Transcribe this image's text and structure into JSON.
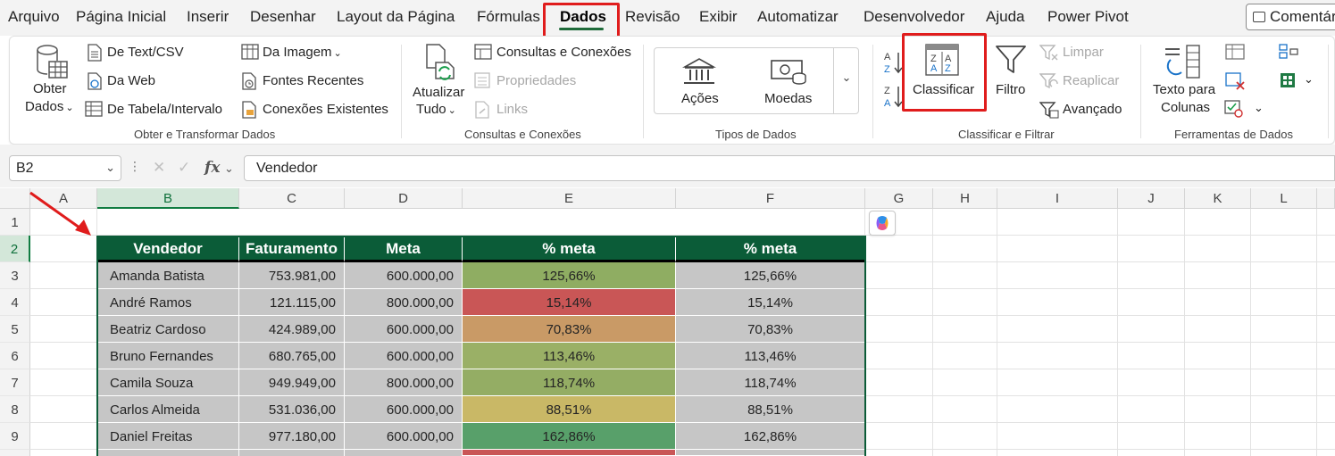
{
  "menu": {
    "items": [
      "Arquivo",
      "Página Inicial",
      "Inserir",
      "Desenhar",
      "Layout da Página",
      "Fórmulas",
      "Dados",
      "Revisão",
      "Exibir",
      "Automatizar",
      "Desenvolvedor",
      "Ajuda",
      "Power Pivot"
    ],
    "active": "Dados",
    "comment_label": "Comentár"
  },
  "ribbon": {
    "get_data": {
      "obter": "Obter",
      "dados": "Dados",
      "from_text": "De Text/CSV",
      "from_web": "Da Web",
      "from_table": "De Tabela/Intervalo",
      "from_image": "Da Imagem",
      "recent_sources": "Fontes Recentes",
      "existing_connections": "Conexões Existentes",
      "group": "Obter e Transformar Dados"
    },
    "queries": {
      "refresh_1": "Atualizar",
      "refresh_2": "Tudo",
      "queries_connections": "Consultas e Conexões",
      "properties": "Propriedades",
      "links": "Links",
      "group": "Consultas e Conexões"
    },
    "data_types": {
      "stocks": "Ações",
      "currencies": "Moedas",
      "group": "Tipos de Dados"
    },
    "sort_filter": {
      "sort": "Classificar",
      "filter": "Filtro",
      "clear": "Limpar",
      "reapply": "Reaplicar",
      "advanced": "Avançado",
      "group": "Classificar e Filtrar"
    },
    "data_tools": {
      "text_to_columns_1": "Texto para",
      "text_to_columns_2": "Colunas",
      "group": "Ferramentas de Dados"
    }
  },
  "formula_bar": {
    "name_box": "B2",
    "fx": "fx",
    "formula": "Vendedor"
  },
  "sheet": {
    "columns": [
      "A",
      "B",
      "C",
      "D",
      "E",
      "F",
      "G",
      "H",
      "I",
      "J",
      "K",
      "L"
    ],
    "rows": [
      "1",
      "2",
      "3",
      "4",
      "5",
      "6",
      "7",
      "8",
      "9"
    ],
    "table": {
      "headers": [
        "Vendedor",
        "Faturamento",
        "Meta",
        "% meta",
        "% meta"
      ],
      "rows": [
        {
          "vendedor": "Amanda Batista",
          "faturamento": "753.981,00",
          "meta": "600.000,00",
          "pct": "125,66%",
          "pct2": "125,66%",
          "color": "#8fad62"
        },
        {
          "vendedor": "André Ramos",
          "faturamento": "121.115,00",
          "meta": "800.000,00",
          "pct": "15,14%",
          "pct2": "15,14%",
          "color": "#c95656"
        },
        {
          "vendedor": "Beatriz Cardoso",
          "faturamento": "424.989,00",
          "meta": "600.000,00",
          "pct": "70,83%",
          "pct2": "70,83%",
          "color": "#c99a66"
        },
        {
          "vendedor": "Bruno Fernandes",
          "faturamento": "680.765,00",
          "meta": "600.000,00",
          "pct": "113,46%",
          "pct2": "113,46%",
          "color": "#9ab066"
        },
        {
          "vendedor": "Camila Souza",
          "faturamento": "949.949,00",
          "meta": "800.000,00",
          "pct": "118,74%",
          "pct2": "118,74%",
          "color": "#94ad64"
        },
        {
          "vendedor": "Carlos Almeida",
          "faturamento": "531.036,00",
          "meta": "600.000,00",
          "pct": "88,51%",
          "pct2": "88,51%",
          "color": "#c9b866"
        },
        {
          "vendedor": "Daniel Freitas",
          "faturamento": "977.180,00",
          "meta": "600.000,00",
          "pct": "162,86%",
          "pct2": "162,86%",
          "color": "#58a06a"
        }
      ]
    }
  }
}
